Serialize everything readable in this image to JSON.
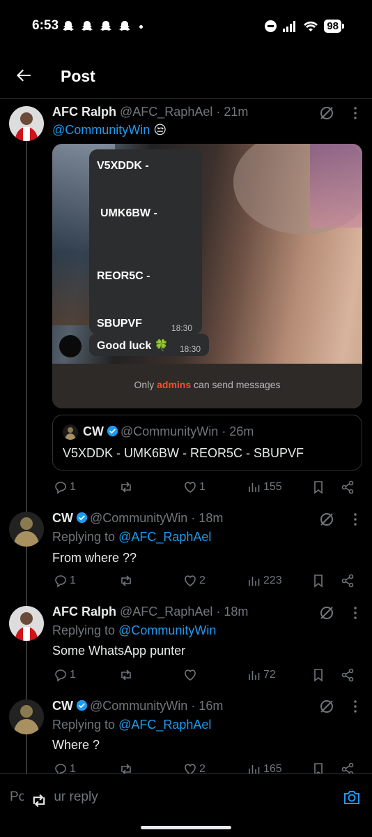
{
  "status_bar": {
    "time": "6:53",
    "battery": "98"
  },
  "header": {
    "title": "Post"
  },
  "post": {
    "name": "AFC Ralph",
    "handle": "@AFC_RaphAel",
    "time": "· 21m",
    "mention": "@CommunityWin",
    "emoji": "😒",
    "media": {
      "codes": [
        "V5XDDK -",
        "UMK6BW -",
        "REOR5C -",
        "SBUPVF"
      ],
      "time1": "18:30",
      "message2": "Good luck 🍀",
      "time2": "18:30",
      "admins_prefix": "Only",
      "admins_word": "admins",
      "admins_suffix": "can send messages"
    },
    "quote": {
      "name": "CW",
      "handle": "@CommunityWin",
      "time": "· 26m",
      "text": "V5XDDK - UMK6BW - REOR5C - SBUPVF"
    },
    "stats": {
      "replies": "1",
      "reposts": "",
      "likes": "1",
      "views": "155"
    }
  },
  "replies": [
    {
      "name": "CW",
      "handle": "@CommunityWin",
      "time": "· 18m",
      "replying_label": "Replying to",
      "replying_to": "@AFC_RaphAel",
      "text": "From where ??",
      "stats": {
        "replies": "1",
        "reposts": "",
        "likes": "2",
        "views": "223"
      }
    },
    {
      "name": "AFC Ralph",
      "handle": "@AFC_RaphAel",
      "time": "· 18m",
      "replying_label": "Replying to",
      "replying_to": "@CommunityWin",
      "text": "Some WhatsApp punter",
      "stats": {
        "replies": "1",
        "reposts": "",
        "likes": "",
        "views": "72"
      }
    },
    {
      "name": "CW",
      "handle": "@CommunityWin",
      "time": "· 16m",
      "replying_label": "Replying to",
      "replying_to": "@AFC_RaphAel",
      "text": "Where ?",
      "stats": {
        "replies": "1",
        "reposts": "",
        "likes": "2",
        "views": "165"
      }
    }
  ],
  "reply_bar": {
    "placeholder": "Post your reply"
  },
  "colors": {
    "accent": "#1d9bf0",
    "muted": "#71767b",
    "admins": "#ff4a2e"
  }
}
